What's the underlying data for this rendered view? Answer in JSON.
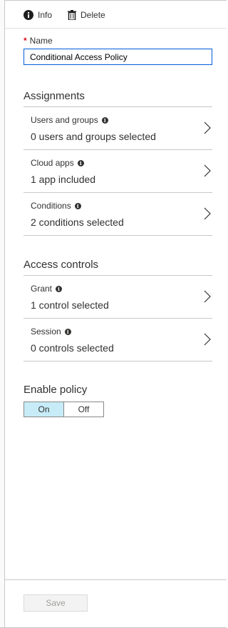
{
  "toolbar": {
    "info_label": "Info",
    "delete_label": "Delete"
  },
  "name_field": {
    "required_marker": "*",
    "label": "Name",
    "value": "Conditional Access Policy"
  },
  "assignments": {
    "title": "Assignments",
    "items": [
      {
        "label": "Users and groups",
        "value": "0 users and groups selected"
      },
      {
        "label": "Cloud apps",
        "value": "1 app included"
      },
      {
        "label": "Conditions",
        "value": "2 conditions selected"
      }
    ]
  },
  "access_controls": {
    "title": "Access controls",
    "items": [
      {
        "label": "Grant",
        "value": "1 control selected"
      },
      {
        "label": "Session",
        "value": "0 controls selected"
      }
    ]
  },
  "enable_policy": {
    "title": "Enable policy",
    "on_label": "On",
    "off_label": "Off",
    "selected": "On"
  },
  "footer": {
    "save_label": "Save"
  },
  "colors": {
    "accent_border": "#015cda",
    "toggle_selected": "#c7ecf8",
    "required": "#e00b1c"
  }
}
